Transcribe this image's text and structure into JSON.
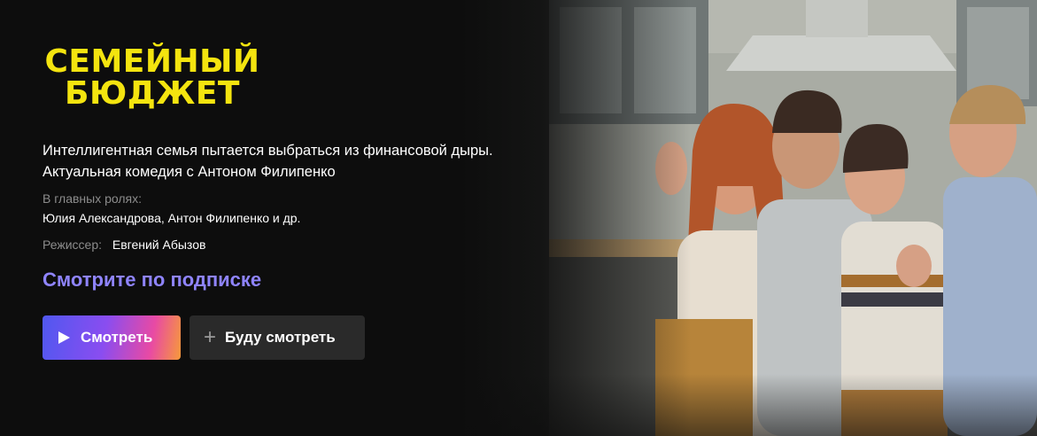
{
  "title": {
    "line1": "СЕМЕЙНЫЙ",
    "line2": "БЮДЖЕТ"
  },
  "description": {
    "line1": "Интеллигентная семья пытается выбраться из финансовой дыры.",
    "line2": "Актуальная комедия с Антоном Филипенко"
  },
  "cast": {
    "label": "В главных ролях:",
    "value": "Юлия Александрова, Антон Филипенко и др."
  },
  "director": {
    "label": "Режиссер:",
    "value": "Евгений Абызов"
  },
  "subscription_text": "Смотрите по подписке",
  "buttons": {
    "watch_label": "Смотреть",
    "watch_icon": "play-icon",
    "later_label": "Буду смотреть",
    "later_icon": "plus-icon"
  },
  "colors": {
    "background": "#0d0d0d",
    "title": "#f4e40f",
    "accent": "#8f84ff",
    "secondary_button": "#2a2a2a"
  }
}
